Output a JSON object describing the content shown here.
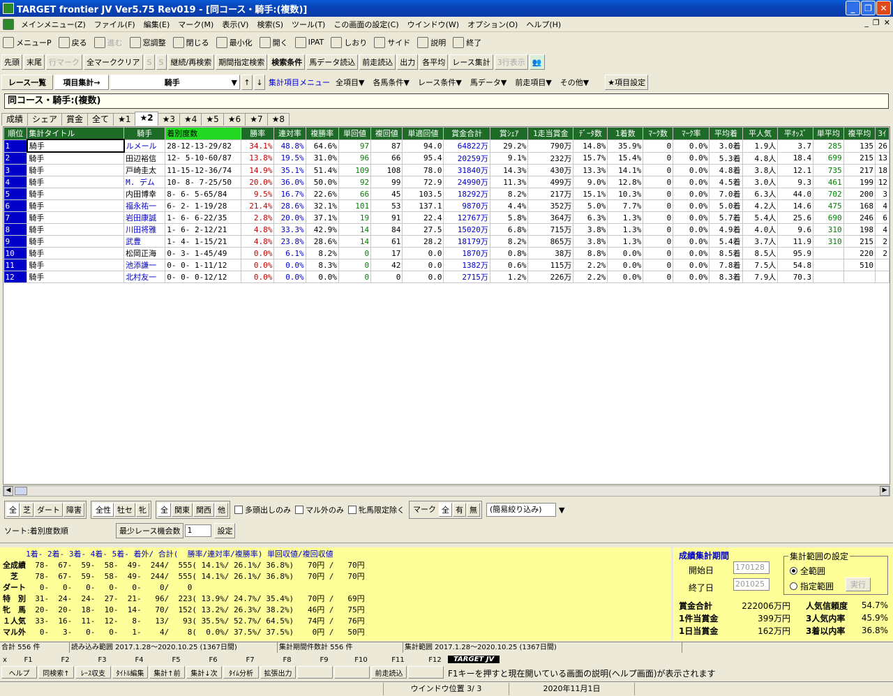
{
  "window": {
    "title": "TARGET frontier JV Ver5.75 Rev019 - [同コース・騎手:(複数)]"
  },
  "menu": [
    "メインメニュー(Z)",
    "ファイル(F)",
    "編集(E)",
    "マーク(M)",
    "表示(V)",
    "検索(S)",
    "ツール(T)",
    "この画面の設定(C)",
    "ウインドウ(W)",
    "オプション(O)",
    "ヘルプ(H)"
  ],
  "toolbar1": [
    {
      "label": "メニューP",
      "icon": "menu-icon"
    },
    {
      "label": "戻る",
      "icon": "up-arrow-icon"
    },
    {
      "label": "進む",
      "icon": "down-arrow-icon",
      "disabled": true
    },
    {
      "label": "窓調整",
      "icon": "window-icon"
    },
    {
      "label": "閉じる",
      "icon": "chart-icon"
    },
    {
      "label": "最小化",
      "icon": "minimize-icon"
    },
    {
      "label": "開く",
      "icon": "open-icon"
    },
    {
      "label": "IPAT",
      "icon": "pat-icon"
    },
    {
      "label": "しおり",
      "icon": "bookmark-icon"
    },
    {
      "label": "サイド",
      "icon": "side-icon"
    },
    {
      "label": "説明",
      "icon": "help-icon"
    },
    {
      "label": "終了",
      "icon": "exit-icon"
    }
  ],
  "toolbar2": [
    {
      "label": "先頭"
    },
    {
      "label": "末尾"
    },
    {
      "label": "行マーク",
      "disabled": true
    },
    {
      "label": "全マーククリア"
    },
    {
      "label": "S",
      "disabled": true
    },
    {
      "label": "S",
      "disabled": true
    },
    {
      "label": "継続/再検索"
    },
    {
      "label": "期間指定検索"
    },
    {
      "label": "検索条件",
      "bold": true
    },
    {
      "label": "馬データ読込"
    },
    {
      "label": "前走読込"
    },
    {
      "label": "出力"
    },
    {
      "label": "各平均"
    },
    {
      "label": "レース集計"
    },
    {
      "label": "3行表示",
      "disabled": true
    }
  ],
  "row3": {
    "race_list": "レース一覧",
    "item_agg": "項目集計→",
    "select_value": "騎手",
    "agg_menu": "集計項目メニュー",
    "menus": [
      "全項目▼",
      "各馬条件▼",
      "レース条件▼",
      "馬データ▼",
      "前走項目▼",
      "その他▼"
    ],
    "item_settings": "★項目設定"
  },
  "header_title": "同コース・騎手:(複数)",
  "tabs": [
    "成績",
    "シェア",
    "賞金",
    "全て",
    "★1",
    "★2",
    "★3",
    "★4",
    "★5",
    "★6",
    "★7",
    "★8"
  ],
  "selected_tab": "★2",
  "columns": [
    "順位",
    "集計タイトル",
    "騎手",
    "着別度数",
    "勝率",
    "連対率",
    "複勝率",
    "単回値",
    "複回値",
    "単適回値",
    "賞金合計",
    "賞ｼｪｱ",
    "1走当賞金",
    "ﾃﾞｰﾀ数",
    "1着数",
    "ﾏｰｸ数",
    "ﾏｰｸ率",
    "平均着",
    "平人気",
    "平ｵｯｽﾞ",
    "単平均",
    "複平均",
    "3ｲ"
  ],
  "rows": [
    [
      "1",
      "騎手",
      "ルメール",
      "28-12-13-29/82",
      "34.1%",
      "48.8%",
      "64.6%",
      "97",
      "87",
      "94.0",
      "64822万",
      "29.2%",
      "790万",
      "14.8%",
      "35.9%",
      "0",
      "0.0%",
      "3.0着",
      "1.9人",
      "3.7",
      "285",
      "135",
      "26"
    ],
    [
      "2",
      "騎手",
      "田辺裕信",
      "12- 5-10-60/87",
      "13.8%",
      "19.5%",
      "31.0%",
      "96",
      "66",
      "95.4",
      "20259万",
      "9.1%",
      "232万",
      "15.7%",
      "15.4%",
      "0",
      "0.0%",
      "5.3着",
      "4.8人",
      "18.4",
      "699",
      "215",
      "13"
    ],
    [
      "3",
      "騎手",
      "戸崎圭太",
      "11-15-12-36/74",
      "14.9%",
      "35.1%",
      "51.4%",
      "109",
      "108",
      "78.0",
      "31840万",
      "14.3%",
      "430万",
      "13.3%",
      "14.1%",
      "0",
      "0.0%",
      "4.8着",
      "3.8人",
      "12.1",
      "735",
      "217",
      "18"
    ],
    [
      "4",
      "騎手",
      "M. デム",
      "10- 8- 7-25/50",
      "20.0%",
      "36.0%",
      "50.0%",
      "92",
      "99",
      "72.9",
      "24990万",
      "11.3%",
      "499万",
      "9.0%",
      "12.8%",
      "0",
      "0.0%",
      "4.5着",
      "3.0人",
      "9.3",
      "461",
      "199",
      "12"
    ],
    [
      "5",
      "騎手",
      "内田博幸",
      "8- 6- 5-65/84",
      "9.5%",
      "16.7%",
      "22.6%",
      "66",
      "45",
      "103.5",
      "18292万",
      "8.2%",
      "217万",
      "15.1%",
      "10.3%",
      "0",
      "0.0%",
      "7.0着",
      "6.3人",
      "44.0",
      "702",
      "200",
      "3"
    ],
    [
      "6",
      "騎手",
      "福永祐一",
      "6- 2- 1-19/28",
      "21.4%",
      "28.6%",
      "32.1%",
      "101",
      "53",
      "137.1",
      "9870万",
      "4.4%",
      "352万",
      "5.0%",
      "7.7%",
      "0",
      "0.0%",
      "5.0着",
      "4.2人",
      "14.6",
      "475",
      "168",
      "4"
    ],
    [
      "7",
      "騎手",
      "岩田康誠",
      "1- 6- 6-22/35",
      "2.8%",
      "20.0%",
      "37.1%",
      "19",
      "91",
      "22.4",
      "12767万",
      "5.8%",
      "364万",
      "6.3%",
      "1.3%",
      "0",
      "0.0%",
      "5.7着",
      "5.4人",
      "25.6",
      "690",
      "246",
      "6"
    ],
    [
      "8",
      "騎手",
      "川田将雅",
      "1- 6- 2-12/21",
      "4.8%",
      "33.3%",
      "42.9%",
      "14",
      "84",
      "27.5",
      "15020万",
      "6.8%",
      "715万",
      "3.8%",
      "1.3%",
      "0",
      "0.0%",
      "4.9着",
      "4.0人",
      "9.6",
      "310",
      "198",
      "4"
    ],
    [
      "9",
      "騎手",
      "武豊",
      "1- 4- 1-15/21",
      "4.8%",
      "23.8%",
      "28.6%",
      "14",
      "61",
      "28.2",
      "18179万",
      "8.2%",
      "865万",
      "3.8%",
      "1.3%",
      "0",
      "0.0%",
      "5.4着",
      "3.7人",
      "11.9",
      "310",
      "215",
      "2"
    ],
    [
      "10",
      "騎手",
      "松岡正海",
      "0- 3- 1-45/49",
      "0.0%",
      "6.1%",
      "8.2%",
      "0",
      "17",
      "0.0",
      "1870万",
      "0.8%",
      "38万",
      "8.8%",
      "0.0%",
      "0",
      "0.0%",
      "8.5着",
      "8.5人",
      "95.9",
      "",
      "220",
      "2"
    ],
    [
      "11",
      "騎手",
      "池添謙一",
      "0- 0- 1-11/12",
      "0.0%",
      "0.0%",
      "8.3%",
      "0",
      "42",
      "0.0",
      "1382万",
      "0.6%",
      "115万",
      "2.2%",
      "0.0%",
      "0",
      "0.0%",
      "7.8着",
      "7.5人",
      "54.8",
      "",
      "510",
      ""
    ],
    [
      "12",
      "騎手",
      "北村友一",
      "0- 0- 0-12/12",
      "0.0%",
      "0.0%",
      "0.0%",
      "0",
      "0",
      "0.0",
      "2715万",
      "1.2%",
      "226万",
      "2.2%",
      "0.0%",
      "0",
      "0.0%",
      "8.3着",
      "7.9人",
      "70.3",
      "",
      "",
      ""
    ]
  ],
  "jockey_blue": [
    true,
    false,
    false,
    true,
    false,
    true,
    true,
    true,
    true,
    false,
    true,
    true
  ],
  "filters": {
    "surface": [
      "全",
      "芝",
      "ダート",
      "障害"
    ],
    "sex": [
      "全性",
      "牡セ",
      "牝"
    ],
    "region": [
      "全",
      "関東",
      "関西",
      "他"
    ],
    "checks": [
      "多頭出しのみ",
      "マル外のみ",
      "牝馬限定除く"
    ],
    "mark_label": "マーク",
    "mark": [
      "全",
      "有",
      "無"
    ],
    "quick": "(簡易絞り込み)"
  },
  "sort": {
    "label": "ソート:着別度数順",
    "min_label": "最少レース機会数",
    "min_value": "1",
    "set": "設定"
  },
  "stats_header": "     1着- 2着- 3着- 4着- 5着- 着外/ 合計(  勝率/連対率/複勝率) 単回収値/複回収値",
  "stats_rows": [
    {
      "label": "全成績",
      "data": "  78-  67-  59-  58-  49-  244/  555( 14.1%/ 26.1%/ 36.8%)   70円 /   70円"
    },
    {
      "label": "　芝　",
      "data": "  78-  67-  59-  58-  49-  244/  555( 14.1%/ 26.1%/ 36.8%)   70円 /   70円"
    },
    {
      "label": "ダート",
      "data": "   0-   0-   0-   0-   0-    0/    0"
    },
    {
      "label": "特　別",
      "data": "  31-  24-  24-  27-  21-   96/  223( 13.9%/ 24.7%/ 35.4%)   70円 /   69円"
    },
    {
      "label": "牝　馬",
      "data": "  20-  20-  18-  10-  14-   70/  152( 13.2%/ 26.3%/ 38.2%)   46円 /   75円"
    },
    {
      "label": "１人気",
      "data": "  33-  16-  11-  12-   8-   13/   93( 35.5%/ 52.7%/ 64.5%)   74円 /   76円"
    },
    {
      "label": "マル外",
      "data": "   0-   3-   0-   0-   1-    4/    8(  0.0%/ 37.5%/ 37.5%)    0円 /   50円"
    }
  ],
  "period": {
    "title": "成績集計期間",
    "start_label": "開始日",
    "start": "170128",
    "end_label": "終了日",
    "end": "201025",
    "range_title": "集計範囲の設定",
    "all": "全範囲",
    "custom": "指定範囲",
    "run": "実行",
    "totals": [
      {
        "k": "賞金合計",
        "v": "222006万円",
        "k2": "人気信頼度",
        "v2": "54.7%"
      },
      {
        "k": "1件当賞金",
        "v": "399万円",
        "k2": "3人気内率",
        "v2": "45.9%"
      },
      {
        "k": "1日当賞金",
        "v": "162万円",
        "k2": "3着以内率",
        "v2": "36.8%"
      }
    ]
  },
  "statusline": [
    "合計 556 件",
    "読み込み範囲 2017.1.28〜2020.10.25 (1367日間)",
    "集計期間件数計 556 件",
    "集計範囲 2017.1.28〜2020.10.25 (1367日間)"
  ],
  "fkeys": [
    "F1",
    "F2",
    "F3",
    "F4",
    "F5",
    "F6",
    "F7",
    "F8",
    "F9",
    "F10",
    "F11",
    "F12"
  ],
  "fbuttons": [
    "ヘルプ",
    "同検索↑",
    "ﾚｰｽ収支",
    "ﾀｲﾄﾙ編集",
    "集計↑前",
    "集計↓次",
    "ﾀｲﾑ分析",
    "拡張出力",
    "",
    "",
    "前走読込",
    ""
  ],
  "target_logo": "TARGET JV",
  "help_text": "F1キーを押すと現在開いている画面の説明(ヘルプ画面)が表示されます",
  "bottom": {
    "window_pos": "ウインドウ位置 3/ 3",
    "date": "2020年11月1日"
  }
}
